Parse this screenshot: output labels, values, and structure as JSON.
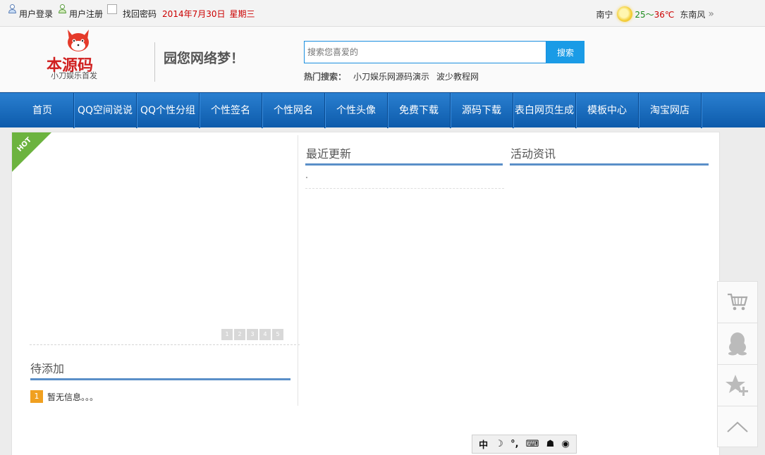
{
  "topbar": {
    "login": "用户登录",
    "register": "用户注册",
    "recover": "找回密码",
    "date": "2014年7月30日",
    "weekday": "星期三",
    "city": "南宁",
    "temp_low": "25",
    "temp_sep": "～",
    "temp_high": "36℃",
    "wind": "东南风",
    "more_icon": "double-chevron-right-icon"
  },
  "header": {
    "logo_text": "本源码",
    "logo_sub": "小刀娱乐首发",
    "slogan": "园您网络梦！",
    "search_placeholder": "搜索您喜爱的",
    "search_button": "搜索",
    "hot_label": "热门搜索：",
    "hot_links": [
      "小刀娱乐网源码演示",
      "波少教程网"
    ]
  },
  "nav": {
    "items": [
      "首页",
      "QQ空间说说",
      "QQ个性分组",
      "个性签名",
      "个性网名",
      "个性头像",
      "免费下载",
      "源码下载",
      "表白网页生成",
      "模板中心",
      "淘宝网店"
    ]
  },
  "main": {
    "hot_badge": "HOT",
    "pager": [
      "1",
      "2",
      "3",
      "4",
      "5"
    ],
    "pending_title": "待添加",
    "pending_items": [
      {
        "num": "1",
        "text": "暂无信息。。。"
      }
    ],
    "recent_title": "最近更新",
    "activity_title": "活动资讯"
  },
  "float_bar": {
    "icons": [
      "cart-icon",
      "qq-penguin-icon",
      "favorite-add-icon",
      "back-to-top-icon"
    ]
  },
  "ime": {
    "items": [
      "中",
      "☽",
      "°,",
      "⌨",
      "☗",
      "◉"
    ]
  },
  "colors": {
    "nav_bg": "#1565b8",
    "accent": "#1a9be6",
    "hot": "#6cb33f",
    "badge": "#f0a020",
    "date": "#cc0000"
  }
}
